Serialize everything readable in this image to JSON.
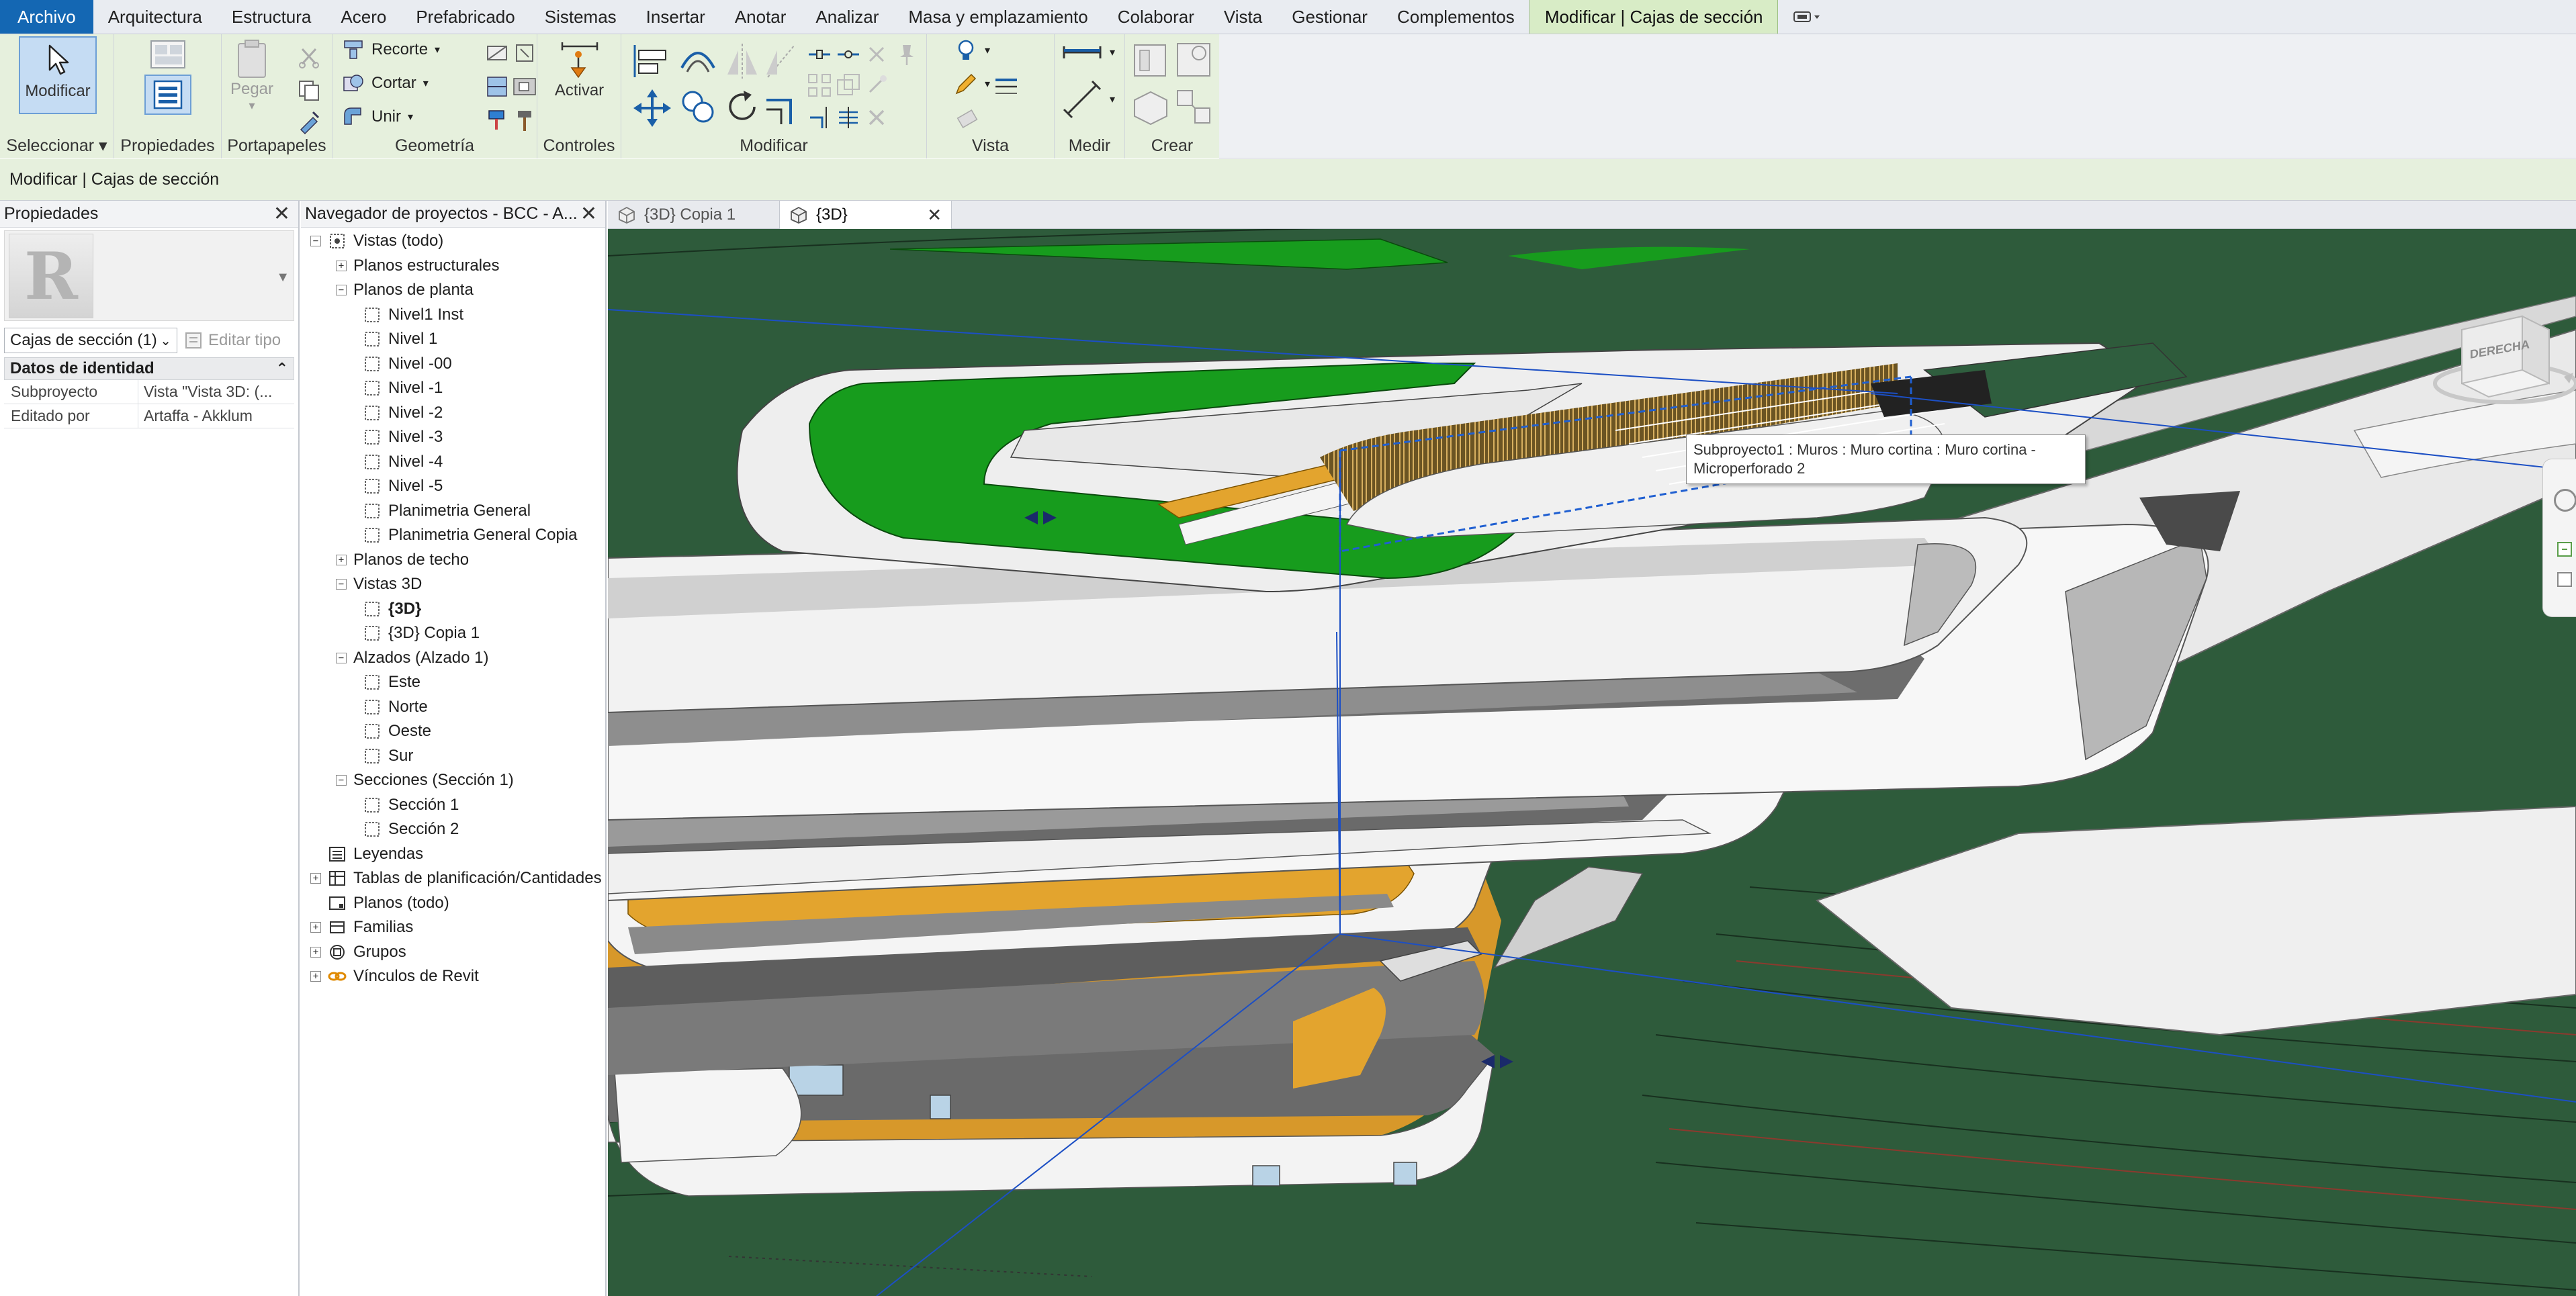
{
  "menu": {
    "tabs": [
      "Archivo",
      "Arquitectura",
      "Estructura",
      "Acero",
      "Prefabricado",
      "Sistemas",
      "Insertar",
      "Anotar",
      "Analizar",
      "Masa y emplazamiento",
      "Colaborar",
      "Vista",
      "Gestionar",
      "Complementos",
      "Modificar | Cajas de sección"
    ],
    "quick_icon": "window-dropdown-icon"
  },
  "ribbon": {
    "select": {
      "button": "Modificar",
      "title": "Seleccionar"
    },
    "properties": {
      "title": "Propiedades"
    },
    "clipboard": {
      "paste": "Pegar",
      "title": "Portapapeles"
    },
    "geometry": {
      "cope": "Recorte",
      "cut": "Cortar",
      "join": "Unir",
      "title": "Geometría"
    },
    "controls": {
      "activate": "Activar",
      "title": "Controles"
    },
    "modify": {
      "title": "Modificar"
    },
    "view": {
      "title": "Vista"
    },
    "measure": {
      "title": "Medir"
    },
    "create": {
      "title": "Crear"
    }
  },
  "context_bar": {
    "label": "Modificar | Cajas de sección"
  },
  "properties": {
    "title": "Propiedades",
    "type_selector": "Cajas de sección (1)",
    "edit_type": "Editar tipo",
    "group": "Datos de identidad",
    "rows": [
      {
        "key": "Subproyecto",
        "value": "Vista \"Vista 3D: (..."
      },
      {
        "key": "Editado por",
        "value": "Artaffa - Akklum"
      }
    ]
  },
  "browser": {
    "title": "Navegador de proyectos - BCC - A...",
    "nodes": [
      {
        "label": "Vistas (todo)",
        "level": 0,
        "exp": "minus",
        "icon": "views"
      },
      {
        "label": "Planos estructurales",
        "level": 1,
        "exp": "plus"
      },
      {
        "label": "Planos de planta",
        "level": 1,
        "exp": "minus"
      },
      {
        "label": "Nivel1 Inst",
        "level": 2
      },
      {
        "label": "Nivel 1",
        "level": 2
      },
      {
        "label": "Nivel -00",
        "level": 2
      },
      {
        "label": "Nivel -1",
        "level": 2
      },
      {
        "label": "Nivel -2",
        "level": 2
      },
      {
        "label": "Nivel -3",
        "level": 2
      },
      {
        "label": "Nivel -4",
        "level": 2
      },
      {
        "label": "Nivel -5",
        "level": 2
      },
      {
        "label": "Planimetria General",
        "level": 2
      },
      {
        "label": "Planimetria General Copia",
        "level": 2
      },
      {
        "label": "Planos de techo",
        "level": 1,
        "exp": "plus"
      },
      {
        "label": "Vistas 3D",
        "level": 1,
        "exp": "minus"
      },
      {
        "label": "{3D}",
        "level": 2,
        "bold": true
      },
      {
        "label": "{3D} Copia 1",
        "level": 2
      },
      {
        "label": "Alzados (Alzado 1)",
        "level": 1,
        "exp": "minus"
      },
      {
        "label": "Este",
        "level": 2
      },
      {
        "label": "Norte",
        "level": 2
      },
      {
        "label": "Oeste",
        "level": 2
      },
      {
        "label": "Sur",
        "level": 2
      },
      {
        "label": "Secciones (Sección 1)",
        "level": 1,
        "exp": "minus"
      },
      {
        "label": "Sección 1",
        "level": 2
      },
      {
        "label": "Sección 2",
        "level": 2
      },
      {
        "label": "Leyendas",
        "level": 0,
        "icon": "legend"
      },
      {
        "label": "Tablas de planificación/Cantidades",
        "level": 0,
        "exp": "plus",
        "icon": "schedule"
      },
      {
        "label": "Planos (todo)",
        "level": 0,
        "icon": "sheet"
      },
      {
        "label": "Familias",
        "level": 0,
        "exp": "plus",
        "icon": "family"
      },
      {
        "label": "Grupos",
        "level": 0,
        "exp": "plus",
        "icon": "group"
      },
      {
        "label": "Vínculos de Revit",
        "level": 0,
        "exp": "plus",
        "icon": "link"
      }
    ]
  },
  "view_tabs": [
    {
      "label": "{3D} Copia 1",
      "active": false
    },
    {
      "label": "{3D}",
      "active": true
    }
  ],
  "viewport": {
    "tooltip_line1": "Subproyecto1 : Muros : Muro cortina : Muro cortina -",
    "tooltip_line2": "Microperforado 2",
    "viewcube_label": "DERECHA"
  },
  "colors": {
    "accent_blue": "#1467b3",
    "context_green": "#d8ecc6",
    "terrain": "#2e5b3b",
    "roof_green": "#179c1d",
    "orange": "#e3a42e",
    "slab": "#f0f0f0",
    "edge_gray": "#6f6f6f"
  }
}
